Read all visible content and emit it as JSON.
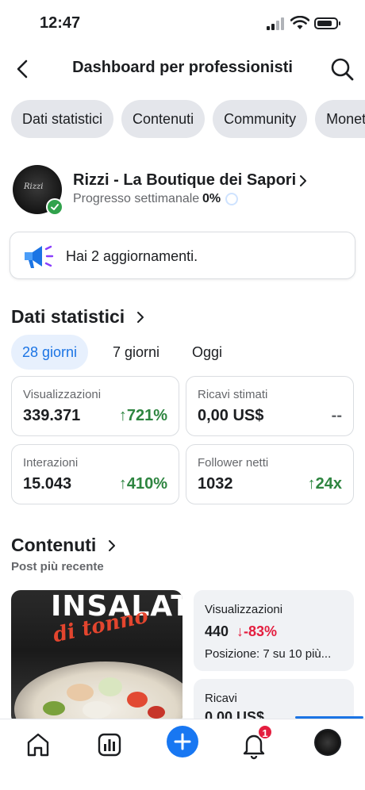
{
  "status": {
    "time": "12:47"
  },
  "header": {
    "title": "Dashboard per professionisti"
  },
  "chips": [
    "Dati statistici",
    "Contenuti",
    "Community",
    "Monetizzazione"
  ],
  "profile": {
    "name": "Rizzi - La Boutique dei Sapori",
    "progress_label": "Progresso settimanale",
    "progress_value": "0%",
    "avatar_text": "Rizzi"
  },
  "updates": {
    "text": "Hai 2 aggiornamenti."
  },
  "stats": {
    "title": "Dati statistici",
    "ranges": [
      "28 giorni",
      "7 giorni",
      "Oggi"
    ],
    "active_range": "28 giorni",
    "cards": [
      {
        "label": "Visualizzazioni",
        "value": "339.371",
        "delta": "↑721%"
      },
      {
        "label": "Ricavi stimati",
        "value": "0,00 US$",
        "delta": "--"
      },
      {
        "label": "Interazioni",
        "value": "15.043",
        "delta": "↑410%"
      },
      {
        "label": "Follower netti",
        "value": "1032",
        "delta": "↑24x"
      }
    ]
  },
  "contenuti": {
    "title": "Contenuti",
    "subtitle": "Post più recente",
    "thumb_title": "INSALATA",
    "thumb_subtitle": "di tonno",
    "metrics": [
      {
        "label": "Visualizzazioni",
        "value": "440",
        "delta": "↓-83%",
        "sub": "Posizione: 7 su 10 più..."
      },
      {
        "label": "Ricavi",
        "value": "0,00 US$"
      }
    ]
  },
  "tabbar": {
    "notifications_count": "1"
  },
  "colors": {
    "accent": "#1877f2",
    "positive": "#2e8540",
    "negative": "#e41e3f",
    "chip_bg": "#e4e6eb",
    "card_bg": "#f0f2f5"
  }
}
